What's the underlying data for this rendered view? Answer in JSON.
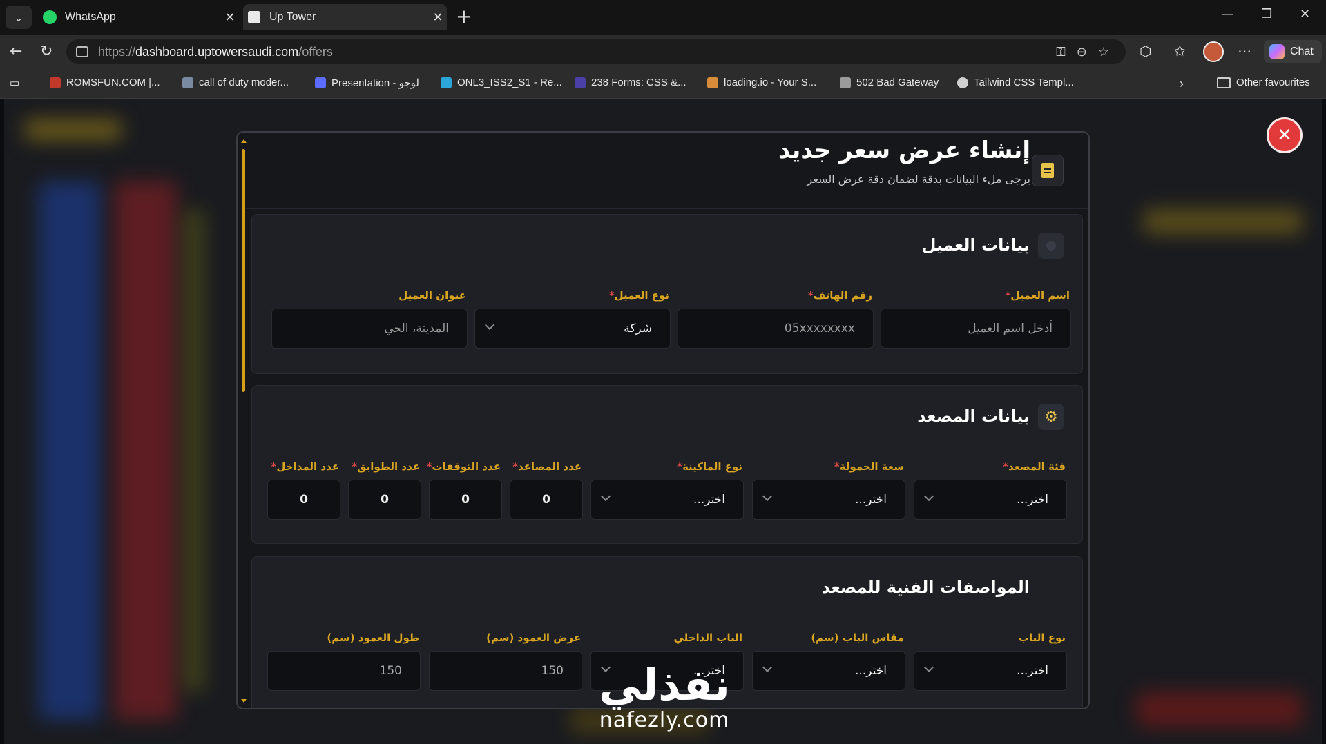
{
  "browser": {
    "tabs": [
      {
        "title": "WhatsApp",
        "active": false
      },
      {
        "title": "Up Tower",
        "active": true
      }
    ],
    "url": {
      "protocol": "https://",
      "domain": "dashboard.uptowersaudi.com",
      "path": "/offers"
    },
    "chat_label": "Chat",
    "bookmarks": [
      "ROMSFUN.COM |...",
      "call of duty moder...",
      "Presentation - لوجو",
      "ONL3_ISS2_S1 - Re...",
      "238 Forms: CSS &...",
      "loading.io - Your S...",
      "502 Bad Gateway",
      "Tailwind CSS Templ..."
    ],
    "other_favourites": "Other favourites"
  },
  "modal": {
    "title": "إنشاء عرض سعر جديد",
    "subtitle": "يرجى ملء البيانات بدقة لضمان دقة عرض السعر",
    "client_section": {
      "title": "بيانات العميل",
      "fields": [
        {
          "label": "اسم العميل",
          "required": "*",
          "placeholder": "أدخل اسم العميل"
        },
        {
          "label": "رقم الهاتف",
          "required": "*",
          "placeholder": "05xxxxxxxx"
        },
        {
          "label": "نوع العميل",
          "required": "*",
          "value": "شركة"
        },
        {
          "label": "عنوان العميل",
          "required": "",
          "placeholder": "المدينة، الحي"
        }
      ]
    },
    "elevator_section": {
      "title": "بيانات المصعد",
      "fields": [
        {
          "label": "فئة المصعد",
          "required": "*",
          "value": "اختر..."
        },
        {
          "label": "سعة الحمولة",
          "required": "*",
          "value": "اختر..."
        },
        {
          "label": "نوع الماكينة",
          "required": "*",
          "value": "اختر..."
        },
        {
          "label": "عدد المصاعد",
          "required": "*",
          "value": "0"
        },
        {
          "label": "عدد التوقفات",
          "required": "*",
          "value": "0"
        },
        {
          "label": "عدد الطوابق",
          "required": "*",
          "value": "0"
        },
        {
          "label": "عدد المداخل",
          "required": "*",
          "value": "0"
        }
      ]
    },
    "specs_section": {
      "title": "المواصفات الفنية للمصعد",
      "fields": [
        {
          "label": "نوع الباب",
          "value": "اختر..."
        },
        {
          "label": "مقاس الباب (سم)",
          "value": "اختر..."
        },
        {
          "label": "الباب الداخلي",
          "value": "اختر..."
        },
        {
          "label": "عرض العمود (سم)",
          "value": "150"
        },
        {
          "label": "طول العمود (سم)",
          "value": "150"
        }
      ]
    }
  },
  "watermark": {
    "arabic": "نفذلي",
    "latin": "nafezly.com"
  },
  "colors": {
    "accent": "#d9a521",
    "danger": "#e23a3a",
    "modal_bg": "#16171b",
    "field_bg": "#0f1013"
  }
}
